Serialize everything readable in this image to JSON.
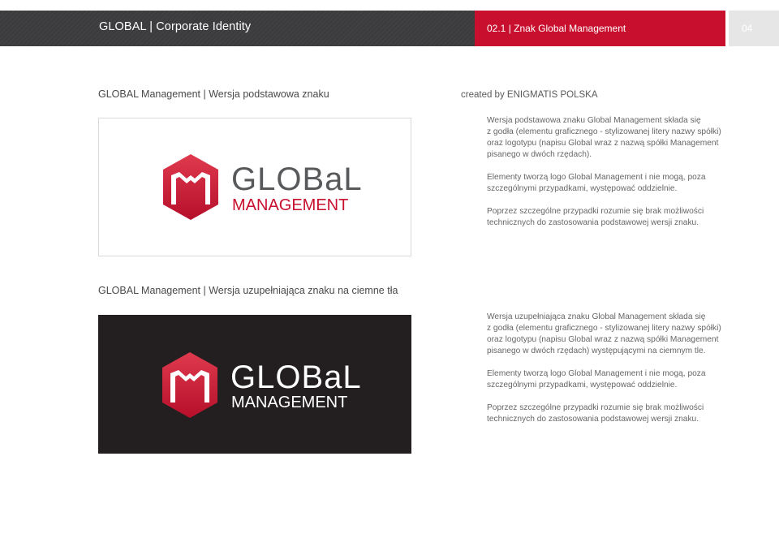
{
  "header": {
    "title": "GLOBAL | Corporate Identity",
    "section": "02.1 | Znak Global Management",
    "page": "04"
  },
  "section1": {
    "title": "GLOBAL Management | Wersja podstawowa znaku",
    "credit": "created by ENIGMATIS POLSKA",
    "paragraphs": [
      [
        "Wersja podstawowa znaku Global Management składa się",
        "z godła (elementu graficznego - stylizowanej litery nazwy spółki)",
        "oraz logotypu (napisu Global wraz z nazwą spółki Management",
        "pisanego w dwóch rzędach)."
      ],
      [
        "Elementy tworzą logo Global Management i nie mogą, poza",
        "szczególnymi przypadkami, występować oddzielnie."
      ],
      [
        "Poprzez szczególne przypadki rozumie się brak możliwości",
        "technicznych do zastosowania podstawowej wersji znaku."
      ]
    ]
  },
  "section2": {
    "title": "GLOBAL Management | Wersja uzupełniająca znaku na ciemne tła",
    "paragraphs": [
      [
        "Wersja uzupełniająca znaku Global Management składa się",
        "z godła (elementu graficznego - stylizowanej litery nazwy spółki)",
        "oraz logotypu (napisu Global wraz z nazwą spółki Management",
        "pisanego w dwóch rzędach) występującymi na ciemnym tle."
      ],
      [
        "Elementy tworzą logo Global Management i nie mogą, poza",
        "szczególnymi przypadkami, występować oddzielnie."
      ],
      [
        "Poprzez szczególne przypadki rozumie się brak możliwości",
        "technicznych do zastosowania podstawowej wersji znaku."
      ]
    ]
  },
  "logo": {
    "word1": "GLOBaL",
    "word2": "MANAGEMENT",
    "colors": {
      "red": "#c8102e",
      "dark_text": "#58595b",
      "white": "#ffffff",
      "dark_bg": "#231f20"
    }
  }
}
